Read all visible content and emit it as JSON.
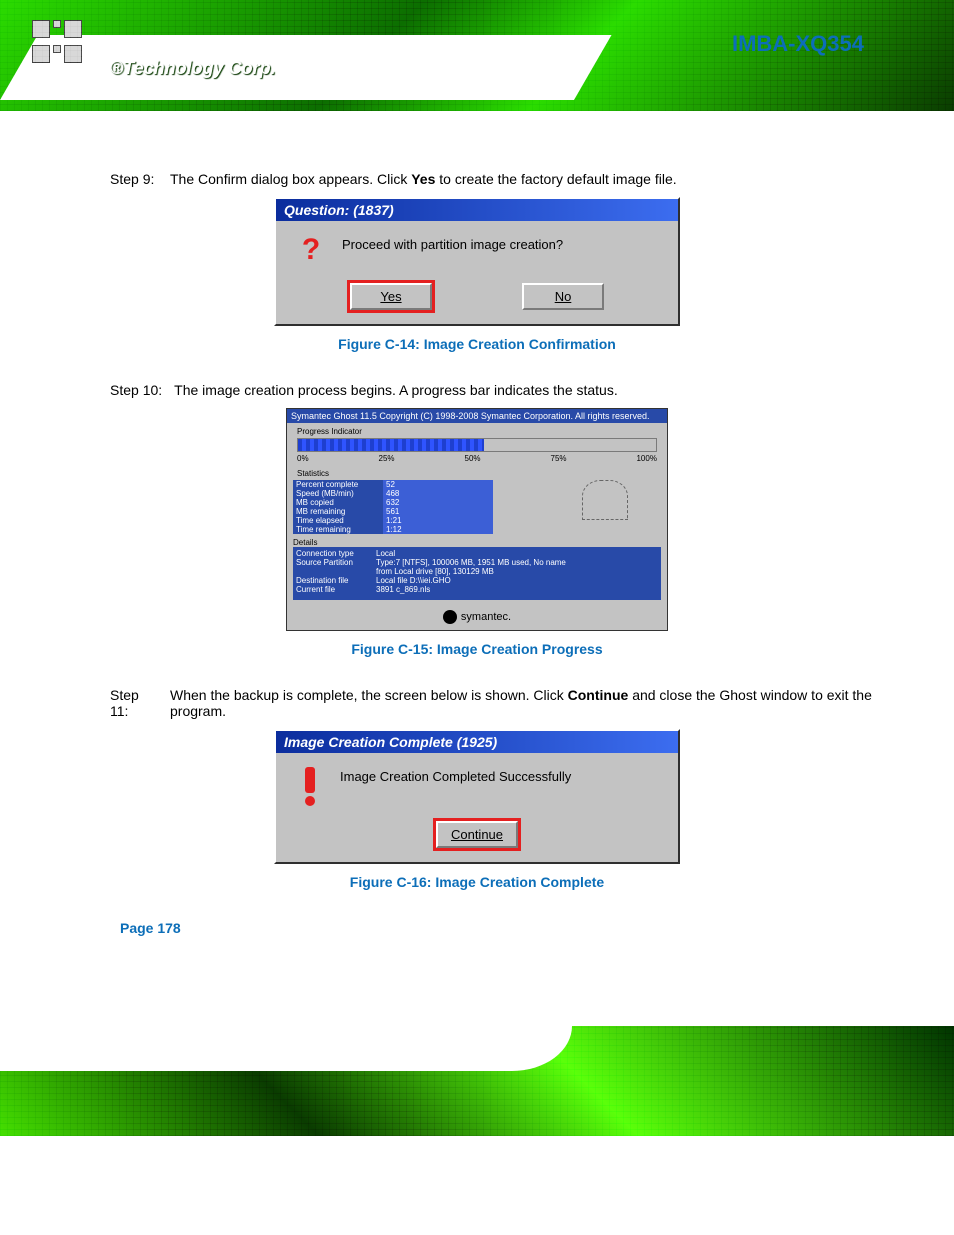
{
  "header": {
    "brand": "®Technology Corp.",
    "doc_title": "IMBA-XQ354"
  },
  "steps": [
    {
      "num": "Step 9:",
      "text_before": "The Confirm dialog box appears. Click ",
      "bold": "Yes",
      "text_after": " to create the factory default image file."
    },
    {
      "num": "Step 10:",
      "text_before": "The image creation process begins. A progress bar indicates the status.",
      "bold": "",
      "text_after": ""
    },
    {
      "num": "Step 11:",
      "text_before": "When the backup is complete, the screen below is shown. Click ",
      "bold": "Continue",
      "text_after": " and close the Ghost window to exit the program."
    }
  ],
  "captions": [
    "Figure C-14: Image Creation Confirmation",
    "Figure C-15: Image Creation Progress",
    "Figure C-16: Image Creation Complete"
  ],
  "dialog1": {
    "title": "Question: (1837)",
    "message": "Proceed with partition image creation?",
    "yes": "Yes",
    "no": "No"
  },
  "ghost": {
    "title": "Symantec Ghost 11.5   Copyright (C) 1998-2008 Symantec Corporation. All rights reserved.",
    "indicator_label": "Progress Indicator",
    "ticks": [
      "0%",
      "25%",
      "50%",
      "75%",
      "100%"
    ],
    "stats_header": "Statistics",
    "stats": [
      [
        "Percent complete",
        "52"
      ],
      [
        "Speed (MB/min)",
        "468"
      ],
      [
        "MB copied",
        "632"
      ],
      [
        "MB remaining",
        "561"
      ],
      [
        "Time elapsed",
        "1:21"
      ],
      [
        "Time remaining",
        "1:12"
      ]
    ],
    "det_header": "Details",
    "details": [
      [
        "Connection type",
        "Local"
      ],
      [
        "Source Partition",
        "Type:7 [NTFS], 100006 MB, 1951 MB used, No name"
      ],
      [
        "",
        "from Local drive [80], 130129 MB"
      ],
      [
        "Destination file",
        "Local file D:\\\\iei.GHO"
      ],
      [
        "Current file",
        "3891 c_869.nls"
      ]
    ],
    "brand": "symantec."
  },
  "dialog2": {
    "title": "Image Creation Complete (1925)",
    "message": "Image Creation Completed Successfully",
    "continue": "Continue"
  },
  "page_number": "Page 178",
  "chart_data": {
    "type": "bar",
    "title": "Ghost image creation progress",
    "categories": [
      "Progress"
    ],
    "values": [
      52
    ],
    "ylim": [
      0,
      100
    ],
    "ylabel": "%"
  }
}
